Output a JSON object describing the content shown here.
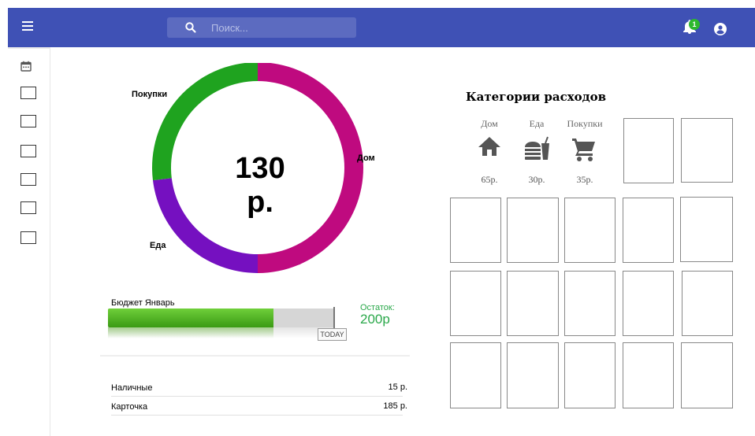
{
  "header": {
    "search_placeholder": "Поиск...",
    "notification_count": "1",
    "bar_color": "#3f51b5"
  },
  "sidebar": {
    "items": [
      {
        "icon": "calendar-icon"
      },
      {
        "icon": "placeholder-box"
      },
      {
        "icon": "placeholder-box"
      },
      {
        "icon": "placeholder-box"
      },
      {
        "icon": "placeholder-box"
      },
      {
        "icon": "placeholder-box"
      },
      {
        "icon": "placeholder-box"
      }
    ]
  },
  "chart_data": {
    "type": "pie",
    "total_label": "130 р.",
    "series": [
      {
        "name": "Дом",
        "value": 65,
        "color": "#bf0a7f"
      },
      {
        "name": "Еда",
        "value": 30,
        "color": "#7510c0"
      },
      {
        "name": "Покупки",
        "value": 35,
        "color": "#1fa31f"
      }
    ]
  },
  "budget": {
    "title": "Бюджет Январь",
    "progress_fraction": 0.73,
    "today_label": "TODAY",
    "remainder_label": "Остаток:",
    "remainder_value": "200р"
  },
  "accounts": [
    {
      "name": "Наличные",
      "value": "15 р."
    },
    {
      "name": "Карточка",
      "value": "185 р."
    }
  ],
  "categories": {
    "title": "Категории расходов",
    "items": [
      {
        "name": "Дом",
        "amount": "65р.",
        "icon": "home-icon"
      },
      {
        "name": "Еда",
        "amount": "30р.",
        "icon": "fastfood-icon"
      },
      {
        "name": "Покупки",
        "amount": "35р.",
        "icon": "shopping-cart-icon"
      }
    ],
    "icon_color": "#555555"
  }
}
